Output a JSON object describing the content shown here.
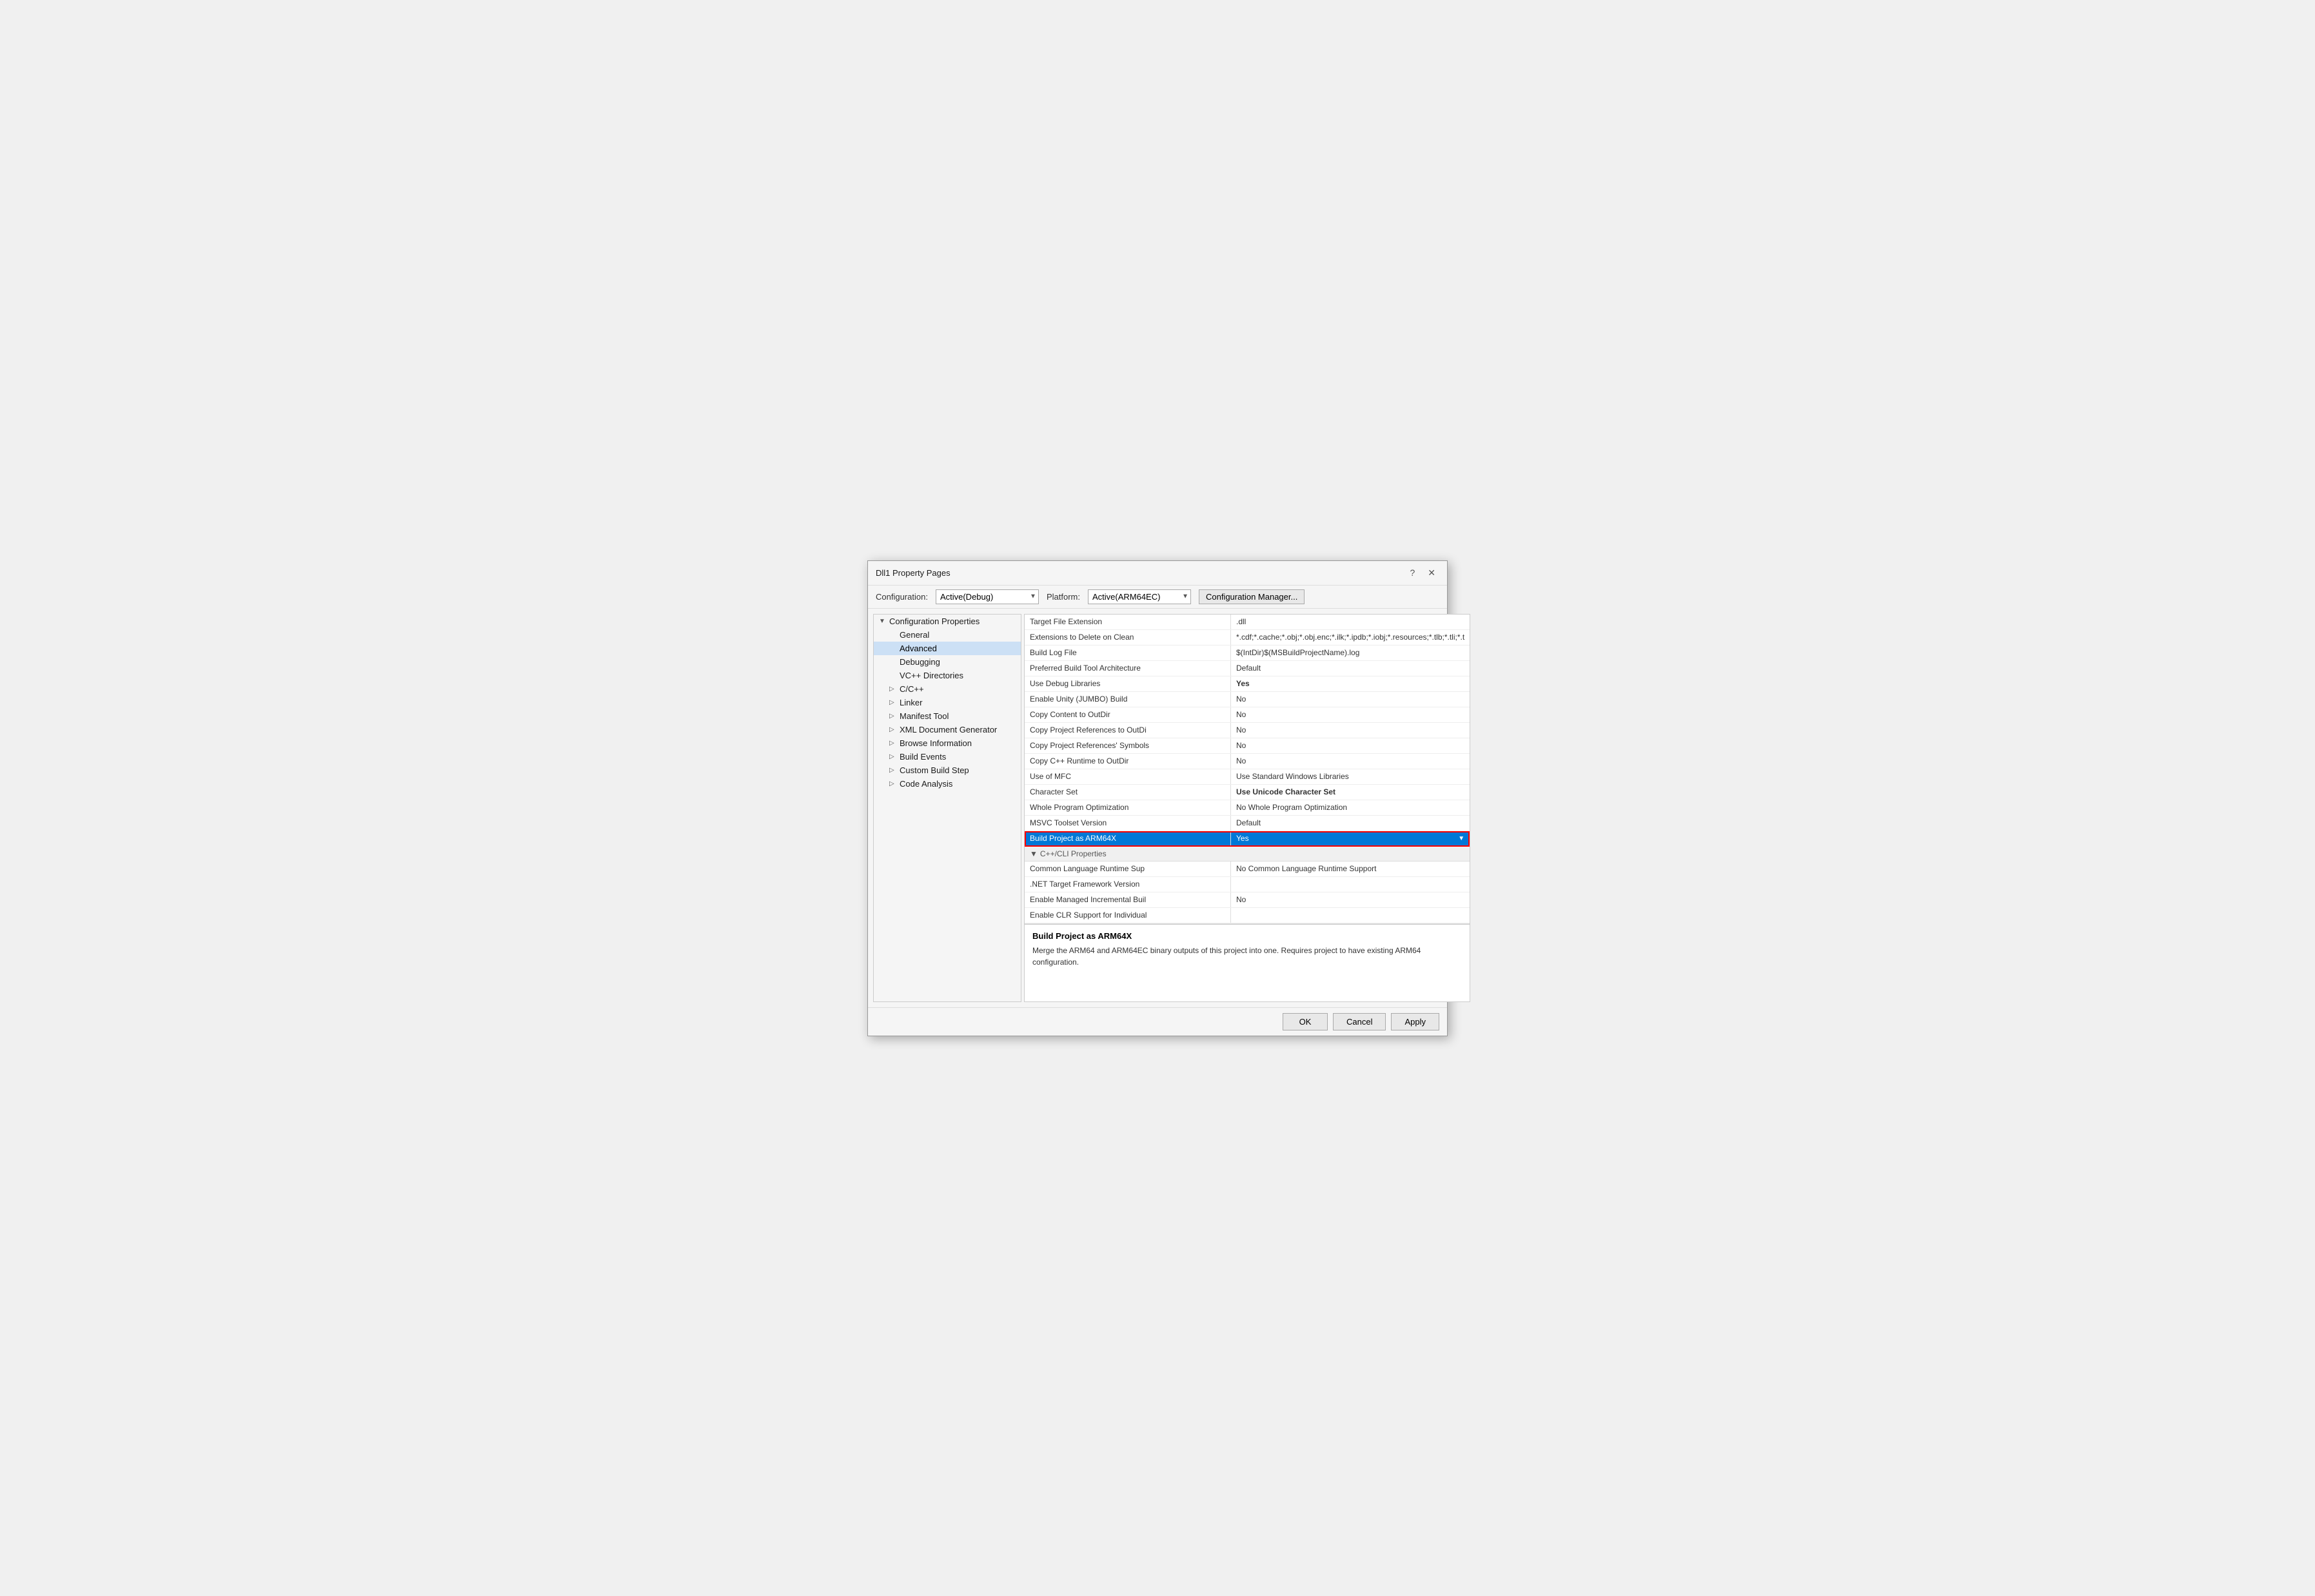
{
  "dialog": {
    "title": "Dll1 Property Pages",
    "help_btn": "?",
    "close_btn": "✕"
  },
  "config_bar": {
    "config_label": "Configuration:",
    "config_value": "Active(Debug)",
    "platform_label": "Platform:",
    "platform_value": "Active(ARM64EC)",
    "manager_btn": "Configuration Manager..."
  },
  "sidebar": {
    "items": [
      {
        "id": "config-properties",
        "label": "Configuration Properties",
        "indent": 0,
        "arrow": "▼",
        "expanded": true
      },
      {
        "id": "general",
        "label": "General",
        "indent": 1,
        "arrow": ""
      },
      {
        "id": "advanced",
        "label": "Advanced",
        "indent": 1,
        "arrow": "",
        "selected": true
      },
      {
        "id": "debugging",
        "label": "Debugging",
        "indent": 1,
        "arrow": ""
      },
      {
        "id": "vc-dirs",
        "label": "VC++ Directories",
        "indent": 1,
        "arrow": ""
      },
      {
        "id": "cpp",
        "label": "C/C++",
        "indent": 1,
        "arrow": "▷"
      },
      {
        "id": "linker",
        "label": "Linker",
        "indent": 1,
        "arrow": "▷"
      },
      {
        "id": "manifest-tool",
        "label": "Manifest Tool",
        "indent": 1,
        "arrow": "▷"
      },
      {
        "id": "xml-doc",
        "label": "XML Document Generator",
        "indent": 1,
        "arrow": "▷"
      },
      {
        "id": "browse-info",
        "label": "Browse Information",
        "indent": 1,
        "arrow": "▷"
      },
      {
        "id": "build-events",
        "label": "Build Events",
        "indent": 1,
        "arrow": "▷"
      },
      {
        "id": "custom-build",
        "label": "Custom Build Step",
        "indent": 1,
        "arrow": "▷"
      },
      {
        "id": "code-analysis",
        "label": "Code Analysis",
        "indent": 1,
        "arrow": "▷"
      }
    ]
  },
  "properties": {
    "rows": [
      {
        "name": "Target File Extension",
        "value": ".dll",
        "bold": false
      },
      {
        "name": "Extensions to Delete on Clean",
        "value": "*.cdf;*.cache;*.obj;*.obj.enc;*.ilk;*.ipdb;*.iobj;*.resources;*.tlb;*.tli;*.t",
        "bold": false
      },
      {
        "name": "Build Log File",
        "value": "$(IntDir)$(MSBuildProjectName).log",
        "bold": false
      },
      {
        "name": "Preferred Build Tool Architecture",
        "value": "Default",
        "bold": false
      },
      {
        "name": "Use Debug Libraries",
        "value": "Yes",
        "bold": true
      },
      {
        "name": "Enable Unity (JUMBO) Build",
        "value": "No",
        "bold": false
      },
      {
        "name": "Copy Content to OutDir",
        "value": "No",
        "bold": false
      },
      {
        "name": "Copy Project References to OutDi",
        "value": "No",
        "bold": false
      },
      {
        "name": "Copy Project References' Symbols",
        "value": "No",
        "bold": false
      },
      {
        "name": "Copy C++ Runtime to OutDir",
        "value": "No",
        "bold": false
      },
      {
        "name": "Use of MFC",
        "value": "Use Standard Windows Libraries",
        "bold": false
      },
      {
        "name": "Character Set",
        "value": "Use Unicode Character Set",
        "bold": true
      },
      {
        "name": "Whole Program Optimization",
        "value": "No Whole Program Optimization",
        "bold": false
      },
      {
        "name": "MSVC Toolset Version",
        "value": "Default",
        "bold": false
      },
      {
        "name": "Build Project as ARM64X",
        "value": "Yes",
        "bold": false,
        "selected": true,
        "highlighted": true
      },
      {
        "name": "C++/CLI Properties",
        "value": "",
        "bold": false,
        "section": true
      }
    ],
    "cpp_cli_rows": [
      {
        "name": "Common Language Runtime Sup",
        "value": "No Common Language Runtime Support",
        "bold": false
      },
      {
        "name": ".NET Target Framework Version",
        "value": "",
        "bold": false
      },
      {
        "name": "Enable Managed Incremental Buil",
        "value": "No",
        "bold": false
      },
      {
        "name": "Enable CLR Support for Individual",
        "value": "",
        "bold": false
      }
    ]
  },
  "description": {
    "title": "Build Project as ARM64X",
    "text": "Merge the ARM64 and ARM64EC binary outputs of this project into one. Requires project to have existing ARM64 configuration."
  },
  "footer": {
    "ok_label": "OK",
    "cancel_label": "Cancel",
    "apply_label": "Apply"
  }
}
